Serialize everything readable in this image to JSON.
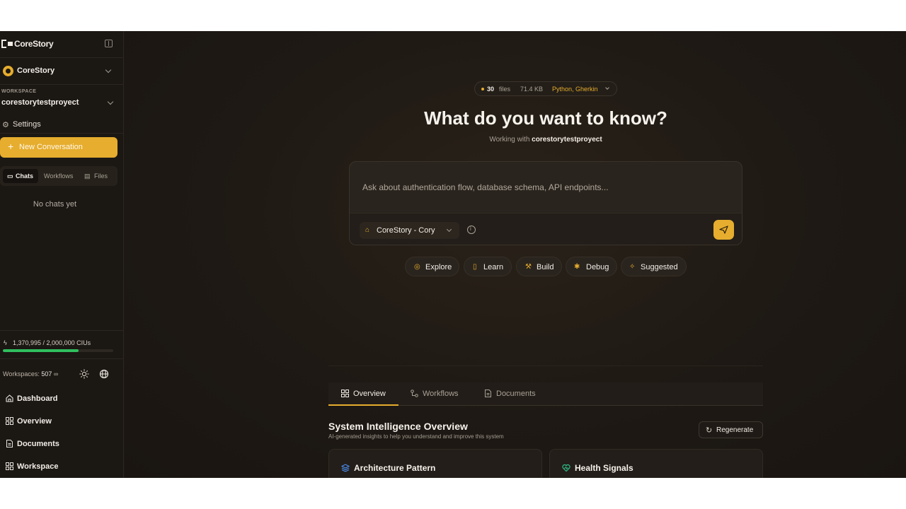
{
  "sidebar": {
    "logo": "CoreStory",
    "org": {
      "name": "CoreStory"
    },
    "workspace": {
      "label": "WORKSPACE",
      "name": "corestorytestproyect"
    },
    "settings_label": "Settings",
    "new_conversation_label": "New Conversation",
    "tabs": [
      {
        "label": "Chats",
        "icon": "chat-icon",
        "active": true
      },
      {
        "label": "Workflows",
        "icon": "",
        "active": false
      },
      {
        "label": "Files",
        "icon": "file-icon",
        "active": false
      }
    ],
    "empty_state": "No chats yet",
    "ciu": {
      "text": "1,370,995 / 2,000,000 CIUs",
      "used": 1370995,
      "total": 2000000,
      "bar_color": "#2fbf5e"
    },
    "workspaces": {
      "label": "Workspaces:",
      "count": "507",
      "limit": "∞"
    },
    "nav": [
      {
        "label": "Dashboard",
        "icon": "home-icon"
      },
      {
        "label": "Overview",
        "icon": "grid-icon"
      },
      {
        "label": "Documents",
        "icon": "document-icon"
      },
      {
        "label": "Workspace",
        "icon": "grid-icon"
      }
    ]
  },
  "main": {
    "repo_pill": {
      "count": "30",
      "files_label": "files",
      "size": "71.4 KB",
      "languages": "Python, Gherkin"
    },
    "hero_title": "What do you want to know?",
    "subtitle_prefix": "Working with",
    "subtitle_workspace": "corestorytestproyect",
    "ask": {
      "placeholder": "Ask about authentication flow, database schema, API endpoints...",
      "value": ""
    },
    "agent_select": "CoreStory - Cory",
    "chips": [
      {
        "label": "Explore",
        "icon": "compass-icon"
      },
      {
        "label": "Learn",
        "icon": "book-icon"
      },
      {
        "label": "Build",
        "icon": "hammer-icon"
      },
      {
        "label": "Debug",
        "icon": "bug-icon"
      },
      {
        "label": "Suggested",
        "icon": "sparkle-icon"
      }
    ],
    "overview_tabs": [
      {
        "label": "Overview",
        "icon": "grid-icon",
        "active": true
      },
      {
        "label": "Workflows",
        "icon": "workflow-icon",
        "active": false
      },
      {
        "label": "Documents",
        "icon": "document-icon",
        "active": false
      }
    ],
    "section_title": "System Intelligence Overview",
    "section_subtitle": "AI-generated insights to help you understand and improve this system",
    "regenerate_label": "Regenerate",
    "cards": [
      {
        "label": "Architecture Pattern",
        "icon": "layers-icon",
        "icon_color": "#4a8df0"
      },
      {
        "label": "Health Signals",
        "icon": "heart-icon",
        "icon_color": "#2fbf8a"
      }
    ]
  },
  "colors": {
    "accent": "#e6ad2e",
    "background": "#1c1814",
    "success": "#2fbf5e"
  }
}
